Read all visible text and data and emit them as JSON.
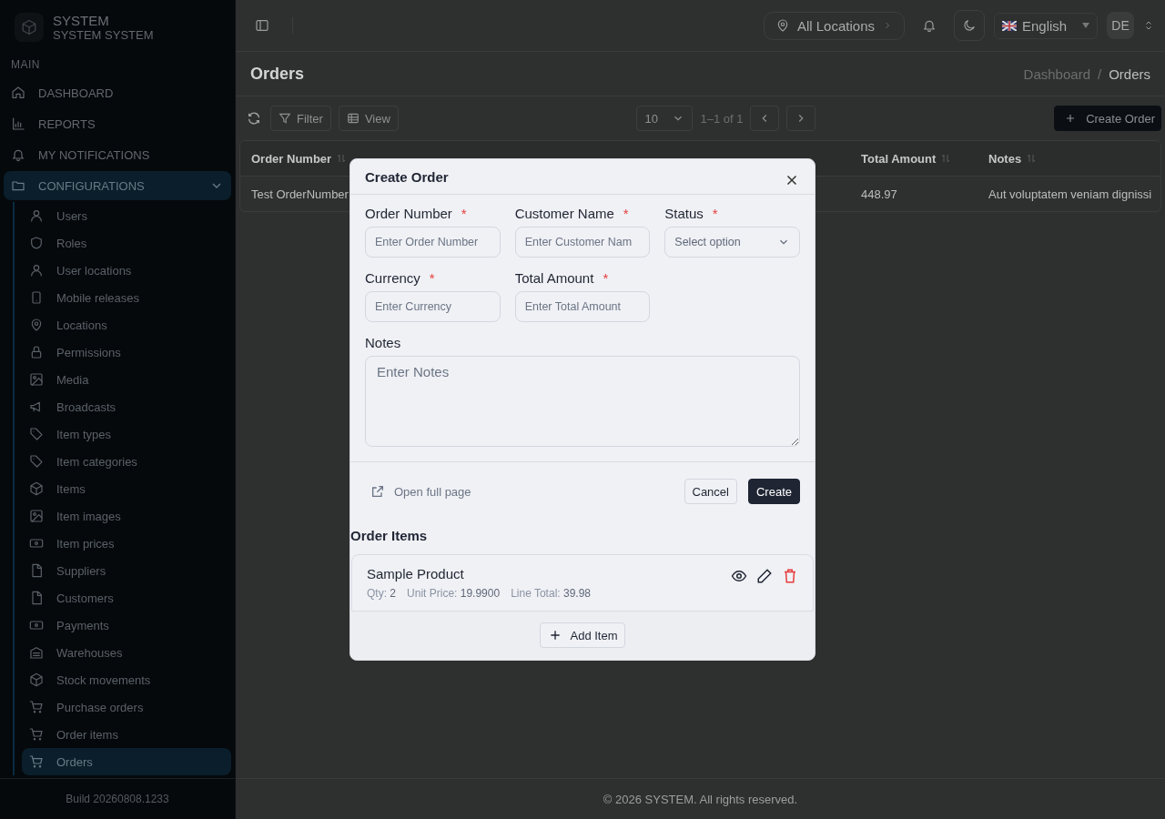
{
  "topbar": {
    "location": "All Locations",
    "language": "English",
    "user_initials": "DE"
  },
  "sidebar": {
    "brand": {
      "title": "SYSTEM",
      "subtitle": "SYSTEM SYSTEM"
    },
    "section": "MAIN",
    "items": [
      {
        "label": "DASHBOARD",
        "selected": false
      },
      {
        "label": "REPORTS",
        "selected": false
      },
      {
        "label": "MY NOTIFICATIONS",
        "selected": false
      },
      {
        "label": "CONFIGURATIONS",
        "selected": true,
        "expanded": true,
        "children": [
          {
            "label": "Users",
            "selected": false
          },
          {
            "label": "Roles",
            "selected": false
          },
          {
            "label": "User locations",
            "selected": false
          },
          {
            "label": "Mobile releases",
            "selected": false
          },
          {
            "label": "Locations",
            "selected": false
          },
          {
            "label": "Permissions",
            "selected": false
          },
          {
            "label": "Media",
            "selected": false
          },
          {
            "label": "Broadcasts",
            "selected": false
          },
          {
            "label": "Item types",
            "selected": false
          },
          {
            "label": "Item categories",
            "selected": false
          },
          {
            "label": "Items",
            "selected": false
          },
          {
            "label": "Item images",
            "selected": false
          },
          {
            "label": "Item prices",
            "selected": false
          },
          {
            "label": "Suppliers",
            "selected": false
          },
          {
            "label": "Customers",
            "selected": false
          },
          {
            "label": "Payments",
            "selected": false
          },
          {
            "label": "Warehouses",
            "selected": false
          },
          {
            "label": "Stock movements",
            "selected": false
          },
          {
            "label": "Purchase orders",
            "selected": false
          },
          {
            "label": "Order items",
            "selected": false
          },
          {
            "label": "Orders",
            "selected": true
          }
        ]
      }
    ],
    "build": "Build 20260808.1233"
  },
  "page": {
    "title": "Orders",
    "separator": "/",
    "breadcrumb": [
      {
        "label": "Dashboard",
        "current": false
      },
      {
        "label": "Orders",
        "current": true
      }
    ]
  },
  "toolbar": {
    "filter": "Filter",
    "view": "View",
    "page_size": "10",
    "range": "1–1 of 1",
    "create": "Create Order"
  },
  "table": {
    "columns": [
      "Order Number",
      "Total Amount",
      "Notes"
    ],
    "rows": [
      [
        "Test OrderNumber",
        "448.97",
        "Aut voluptatem veniam dignissi"
      ]
    ]
  },
  "dialog": {
    "title": "Create Order",
    "required_mark": "*",
    "fields": [
      {
        "kind": "text",
        "label": "Order Number",
        "required": true,
        "placeholder": "Enter Order Number"
      },
      {
        "kind": "text",
        "label": "Customer Name",
        "required": true,
        "placeholder": "Enter Customer Nam"
      },
      {
        "kind": "select",
        "label": "Status",
        "required": true,
        "placeholder": "Select option"
      },
      {
        "kind": "text",
        "label": "Currency",
        "required": true,
        "placeholder": "Enter Currency"
      },
      {
        "kind": "text",
        "label": "Total Amount",
        "required": true,
        "placeholder": "Enter Total Amount"
      },
      {
        "kind": "textarea",
        "label": "Notes",
        "required": false,
        "placeholder": "Enter Notes"
      }
    ],
    "open_full_page": "Open full page",
    "buttons": [
      "Cancel",
      "Create"
    ]
  },
  "order_items": {
    "title": "Order Items",
    "items": [
      {
        "name": "Sample Product",
        "details": [
          {
            "label": "Qty:",
            "value": "2"
          },
          {
            "label": "Unit Price:",
            "value": "19.9900"
          },
          {
            "label": "Line Total:",
            "value": "39.98"
          }
        ]
      }
    ],
    "add": "Add Item"
  },
  "footer": "© 2026 SYSTEM. All rights reserved."
}
